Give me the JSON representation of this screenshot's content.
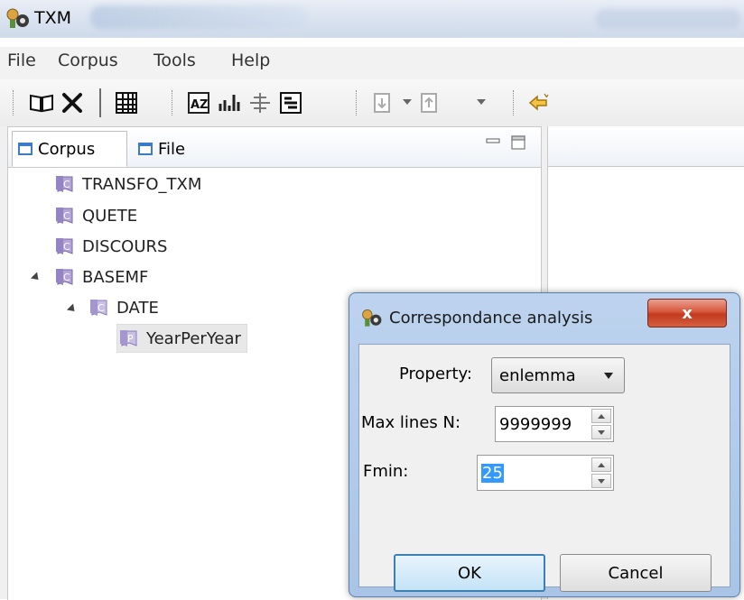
{
  "window": {
    "title": "TXM",
    "logo_icon": "txm-logo-icon"
  },
  "menu": [
    {
      "label": "File"
    },
    {
      "label": "Corpus"
    },
    {
      "label": "Tools"
    },
    {
      "label": "Help"
    }
  ],
  "toolbar": {
    "icons": [
      "open-book-icon",
      "delete-x-icon",
      "table-icon",
      "sort-az-icon",
      "chart-icon",
      "cross-icon",
      "concordance-icon",
      "import-icon",
      "export-icon",
      "back-arrow-icon"
    ]
  },
  "left_view": {
    "tabs": [
      {
        "label": "Corpus",
        "active": true
      },
      {
        "label": "File",
        "active": false
      }
    ],
    "tree": [
      {
        "label": "TRANSFO_TXM",
        "icon": "C",
        "depth": 0,
        "expanded": false
      },
      {
        "label": "QUETE",
        "icon": "C",
        "depth": 0,
        "expanded": false
      },
      {
        "label": "DISCOURS",
        "icon": "C",
        "depth": 0,
        "expanded": false
      },
      {
        "label": "BASEMF",
        "icon": "C",
        "depth": 0,
        "expanded": true
      },
      {
        "label": "DATE",
        "icon": "C",
        "depth": 1,
        "expanded": true
      },
      {
        "label": "YearPerYear",
        "icon": "P",
        "depth": 2,
        "selected": true
      }
    ]
  },
  "dialog": {
    "title": "Correspondance analysis",
    "close_label": "x",
    "property_label": "Property:",
    "property_value": "enlemma",
    "max_lines_label": "Max lines N:",
    "max_lines_value": "9999999",
    "fmin_label": "Fmin:",
    "fmin_value": "25",
    "ok_label": "OK",
    "cancel_label": "Cancel"
  },
  "colors": {
    "accent_blue": "#3c7fb1",
    "close_red": "#c23a20",
    "corpus_icon_purple": "#8a72b8",
    "selection": "#3399ff"
  }
}
